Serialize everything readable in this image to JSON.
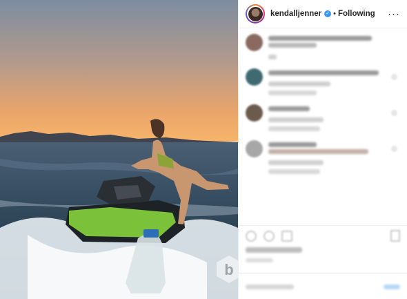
{
  "post": {
    "username": "kendalljenner",
    "follow_status": "Following",
    "separator": "•",
    "more_icon": "more-dots-icon",
    "verified_icon": "verified-badge-icon"
  },
  "colors": {
    "accent": "#3897f0",
    "text": "#262626",
    "divider": "#efefef"
  },
  "watermark": {
    "letter": "b"
  }
}
